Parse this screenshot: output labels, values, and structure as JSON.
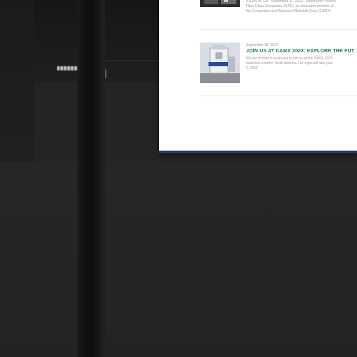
{
  "posts": [
    {
      "date": "",
      "title": "",
      "excerpt": "ATLANTA, GA - September 11, 2023 - Sutherland Presses\nFiber Glass Companies (MFG), an innovative provider of\nthe Composites and Advanced Materials Expo (CAMX)"
    },
    {
      "date": "September 18, 2023",
      "title": "JOIN US AT CAMX 2023: EXPLORE THE FUT",
      "excerpt": "We are thrilled to invite you to join us at the CAMX 2023\nmaterials event in North America.The expo will take plac\n2, 2023"
    }
  ],
  "colors": {
    "title_green": "#1f7a4d",
    "screen_border": "#2b3a6b",
    "background": "#242424"
  }
}
